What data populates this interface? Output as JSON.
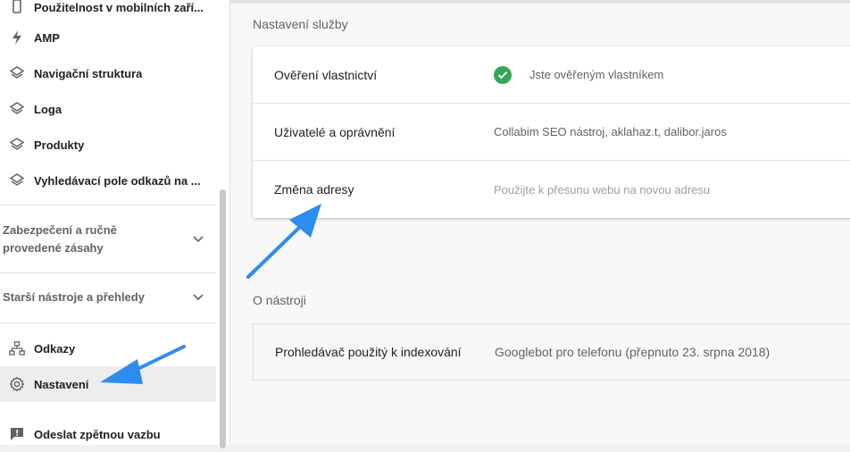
{
  "sidebar": {
    "items": [
      {
        "label": "Použitelnost v mobilních zaří...",
        "icon": "phone-icon"
      },
      {
        "label": "AMP",
        "icon": "lightning-icon"
      },
      {
        "label": "Navigační struktura",
        "icon": "layers-icon"
      },
      {
        "label": "Loga",
        "icon": "layers-icon"
      },
      {
        "label": "Produkty",
        "icon": "layers-icon"
      },
      {
        "label": "Vyhledávací pole odkazů na ...",
        "icon": "layers-icon"
      }
    ],
    "sections": [
      {
        "label": "Zabezpečení a ručně provedené zásahy",
        "expanded": false
      },
      {
        "label": "Starší nástroje a přehledy",
        "expanded": false
      }
    ],
    "bottom_items": [
      {
        "label": "Odkazy",
        "icon": "sitemap-icon"
      },
      {
        "label": "Nastavení",
        "icon": "gear-icon",
        "active": true
      },
      {
        "label": "Odeslat zpětnou vazbu",
        "icon": "feedback-icon"
      }
    ]
  },
  "main": {
    "service_settings": {
      "title": "Nastavení služby",
      "rows": [
        {
          "label": "Ověření vlastnictví",
          "value": "Jste ověřeným vlastníkem"
        },
        {
          "label": "Uživatelé a oprávnění",
          "value": "Collabim SEO nástroj, aklahaz.t, dalibor.jaros"
        },
        {
          "label": "Změna adresy",
          "value": "Použijte k přesunu webu na novou adresu"
        }
      ]
    },
    "about": {
      "title": "O nástroji",
      "rows": [
        {
          "label": "Prohledávač použitý k indexování",
          "value": "Googlebot pro telefonu (přepnuto 23. srpna 2018)"
        }
      ]
    }
  },
  "colors": {
    "accent_arrow": "#2d8cf0",
    "check_green": "#34a853",
    "active_bg": "#ededed"
  }
}
